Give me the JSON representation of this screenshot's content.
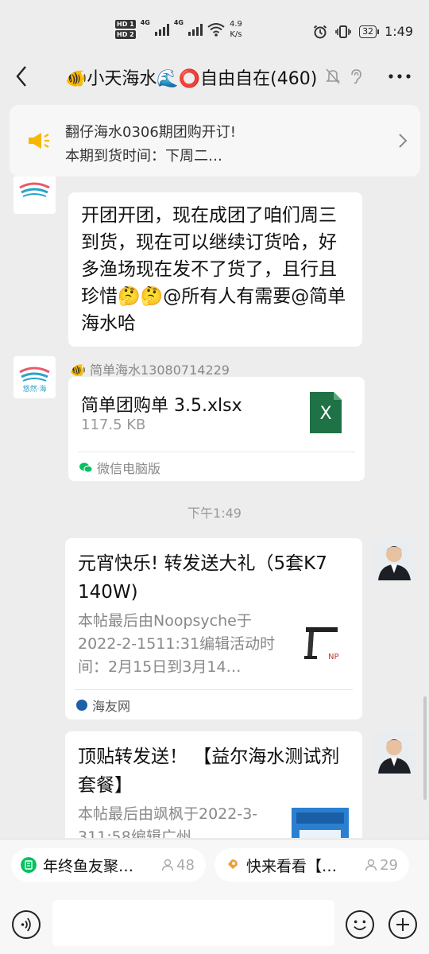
{
  "status_bar": {
    "hd1": "HD 1",
    "hd2": "HD 2",
    "net1": "4G",
    "net2": "4G",
    "speed_value": "4.9",
    "speed_unit": "K/s",
    "battery": "32",
    "time": "1:49"
  },
  "nav": {
    "back_icon": "chevron-left",
    "title": "🐠小天海水🌊⭕自由自在(460)",
    "more_icon": "ellipsis"
  },
  "notice": {
    "line1": "翻仔海水0306期团购开订!",
    "line2": "本期到货时间：下周二…"
  },
  "messages": [
    {
      "type": "text",
      "avatar_label": "悠然·海",
      "text": "开团开团，现在成团了咱们周三到货，现在可以继续订货哈，好多渔场现在发不了货了，且行且珍惜🤔🤔@所有人有需要@简单海水哈"
    },
    {
      "type": "file",
      "avatar_label": "悠然·海",
      "sender": "🐠 简单海水13080714229",
      "file_name": "简单团购单 3.5.xlsx",
      "file_size": "117.5 KB",
      "file_icon_letter": "X",
      "source": "微信电脑版"
    },
    {
      "type": "time",
      "text": "下午1:49"
    },
    {
      "type": "link",
      "title": "元宵快乐! 转发送大礼（5套K7 140W)",
      "desc": "本帖最后由Noopsyche于2022-2-1511:31编辑活动时间：2月15日到3月14…",
      "source": "海友网"
    },
    {
      "type": "link",
      "title": "顶贴转发送！ 【益尔海水测试剂套餐】",
      "desc": "本帖最后由飒枫于2022-3-311:58编辑广州…"
    }
  ],
  "quick_pills": [
    {
      "label": "年终鱼友聚…",
      "count": "48"
    },
    {
      "label": "快来看看【…",
      "count": "29"
    }
  ],
  "colors": {
    "background": "#ededed",
    "bubble": "#ffffff",
    "excel_green": "#1f7245",
    "wechat_green": "#07c160",
    "horn_yellow": "#f5b800"
  }
}
